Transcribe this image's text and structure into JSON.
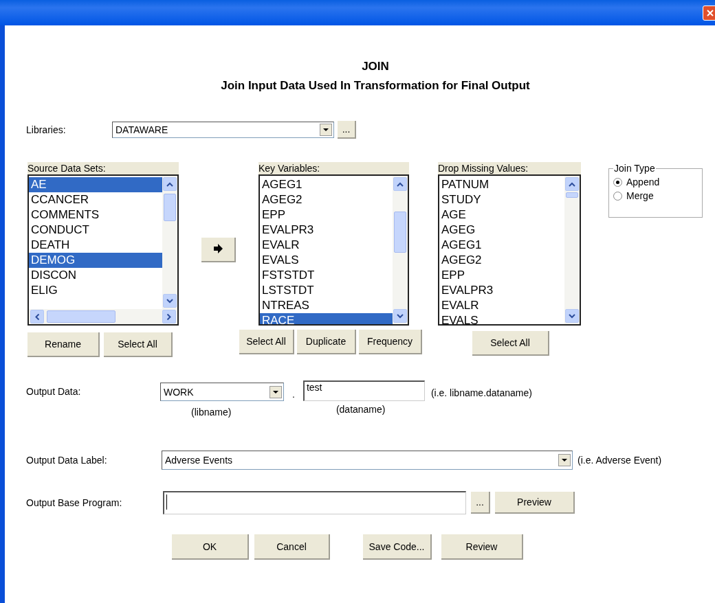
{
  "heading": "JOIN",
  "subheading": "Join Input Data Used In Transformation for Final Output",
  "libraries": {
    "label": "Libraries:",
    "value": "DATAWARE",
    "browse_button": "..."
  },
  "source_data_sets": {
    "label": "Source Data Sets:",
    "items": [
      {
        "text": "AE",
        "selected": true
      },
      {
        "text": "CCANCER",
        "selected": false
      },
      {
        "text": "COMMENTS",
        "selected": false
      },
      {
        "text": "CONDUCT",
        "selected": false
      },
      {
        "text": "DEATH",
        "selected": false
      },
      {
        "text": "DEMOG",
        "selected": true
      },
      {
        "text": "DISCON",
        "selected": false
      },
      {
        "text": "ELIG",
        "selected": false
      }
    ],
    "buttons": [
      "Rename",
      "Select All"
    ]
  },
  "key_variables": {
    "label": "Key Variables:",
    "items": [
      {
        "text": "AGEG1",
        "selected": false
      },
      {
        "text": "AGEG2",
        "selected": false
      },
      {
        "text": "EPP",
        "selected": false
      },
      {
        "text": "EVALPR3",
        "selected": false
      },
      {
        "text": "EVALR",
        "selected": false
      },
      {
        "text": "EVALS",
        "selected": false
      },
      {
        "text": "FSTSTDT",
        "selected": false
      },
      {
        "text": "LSTSTDT",
        "selected": false
      },
      {
        "text": "NTREAS",
        "selected": false
      },
      {
        "text": "RACE",
        "selected": true
      }
    ],
    "buttons": [
      "Select All",
      "Duplicate",
      "Frequency"
    ]
  },
  "drop_missing_values": {
    "label": "Drop Missing Values:",
    "items": [
      {
        "text": "PATNUM",
        "selected": false
      },
      {
        "text": "STUDY",
        "selected": false
      },
      {
        "text": "AGE",
        "selected": false
      },
      {
        "text": "AGEG",
        "selected": false
      },
      {
        "text": "AGEG1",
        "selected": false
      },
      {
        "text": "AGEG2",
        "selected": false
      },
      {
        "text": "EPP",
        "selected": false
      },
      {
        "text": "EVALPR3",
        "selected": false
      },
      {
        "text": "EVALR",
        "selected": false
      },
      {
        "text": "EVALS",
        "selected": false
      }
    ],
    "buttons": [
      "Select All"
    ]
  },
  "join_type": {
    "label": "Join Type",
    "options": [
      {
        "label": "Append",
        "selected": true
      },
      {
        "label": "Merge",
        "selected": false
      }
    ]
  },
  "output_data": {
    "label": "Output Data:",
    "libname": "WORK",
    "libname_caption": "(libname)",
    "separator": ".",
    "dataname": "test",
    "dataname_caption": "(dataname)",
    "hint": "(i.e. libname.dataname)"
  },
  "output_data_label": {
    "label": "Output Data Label:",
    "value": "Adverse Events",
    "hint": "(i.e. Adverse Event)"
  },
  "output_base_program": {
    "label": "Output Base Program:",
    "browse_button": "...",
    "preview_button": "Preview"
  },
  "buttons": [
    "OK",
    "Cancel",
    "Save Code...",
    "Review"
  ]
}
